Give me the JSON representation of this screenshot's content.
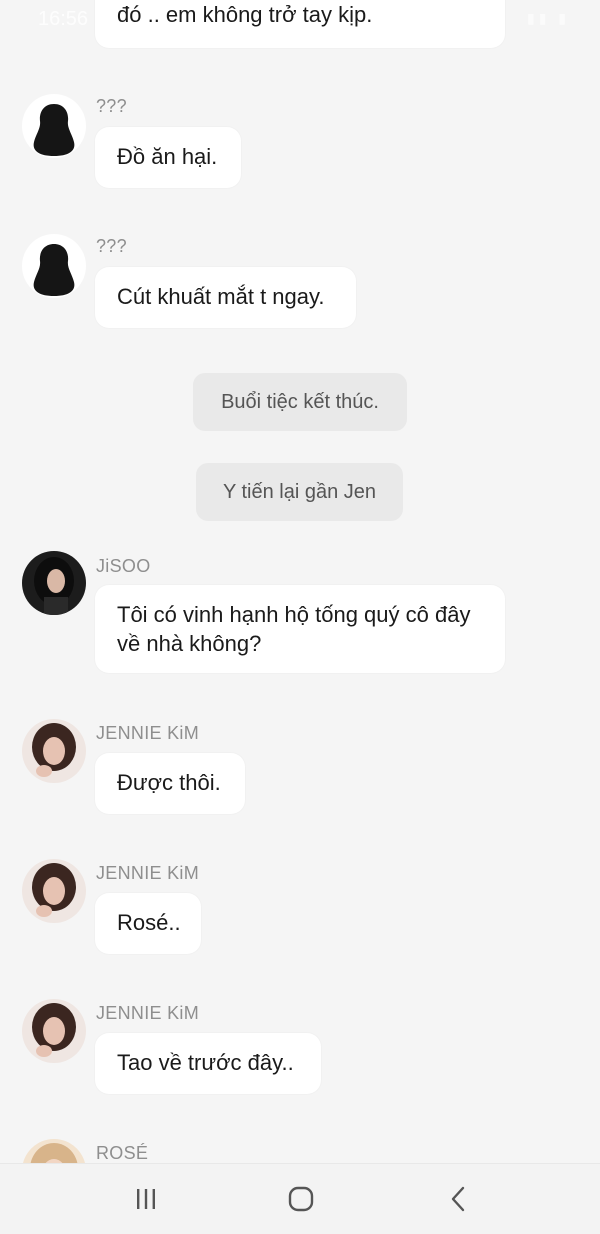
{
  "status_bar": {
    "time": "16:56"
  },
  "messages": [
    {
      "sender": "",
      "text": "đó .. em không trở tay kịp."
    },
    {
      "sender": "???",
      "text": "Đồ ăn hại."
    },
    {
      "sender": "???",
      "text": "Cút khuất mắt t ngay."
    },
    {
      "narration": "Buổi tiệc kết thúc."
    },
    {
      "narration": "Y tiến lại gần Jen"
    },
    {
      "sender": "JiSOO",
      "text": "Tôi có vinh hạnh hộ tống quý cô đây về nhà không?"
    },
    {
      "sender": "JENNIE KiM",
      "text": "Được thôi."
    },
    {
      "sender": "JENNIE KiM",
      "text": "Rosé.."
    },
    {
      "sender": "JENNIE KiM",
      "text": "Tao về trước đây.."
    },
    {
      "sender": "ROSÉ",
      "text": ""
    }
  ],
  "nav_bar": {
    "items": [
      "recent-apps",
      "home",
      "back"
    ]
  }
}
